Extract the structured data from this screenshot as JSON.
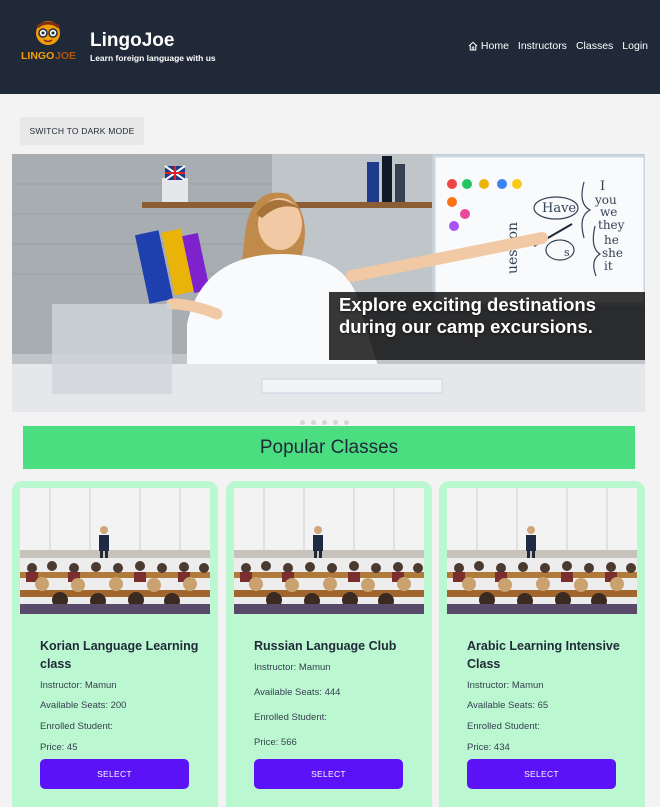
{
  "brand": {
    "logo_text": "LINGO JOE",
    "logo_text_a": "LINGO",
    "logo_text_b": "JOE",
    "name": "LingoJoe",
    "tagline": "Learn foreign language with us"
  },
  "nav": {
    "items": [
      {
        "label": "Home",
        "icon": "home-icon"
      },
      {
        "label": "Instructors"
      },
      {
        "label": "Classes"
      },
      {
        "label": "Login"
      }
    ]
  },
  "theme_toggle": {
    "label": "SWITCH TO DARK MODE"
  },
  "hero": {
    "caption_line1": "Explore exciting destinations",
    "caption_line2": "during our camp excursions.",
    "board_words": [
      "Have",
      "I",
      "you",
      "we",
      "they",
      "he",
      "she",
      "it",
      "uestion",
      "s"
    ]
  },
  "popular": {
    "title": "Popular Classes",
    "cards": [
      {
        "title": "Korian Language Learning class",
        "instructor": "Instructor: Mamun",
        "seats": "Available Seats: 200",
        "enrolled": "Enrolled Student:",
        "price": "Price: 45",
        "button": "SELECT"
      },
      {
        "title": "Russian Language Club",
        "instructor": "Instructor: Mamun",
        "seats": "Available Seats: 444",
        "enrolled": "Enrolled Student:",
        "price": "Price: 566",
        "button": "SELECT"
      },
      {
        "title": "Arabic Learning Intensive Class",
        "instructor": "Instructor: Mamun",
        "seats": "Available Seats: 65",
        "enrolled": "Enrolled Student:",
        "price": "Price: 434",
        "button": "SELECT"
      }
    ]
  },
  "colors": {
    "header_bg": "#1f2937",
    "accent_green": "#4ade80",
    "card_bg": "#bbf7d0",
    "button_purple": "#5b12f6",
    "logo_orange": "#f59e0b"
  }
}
